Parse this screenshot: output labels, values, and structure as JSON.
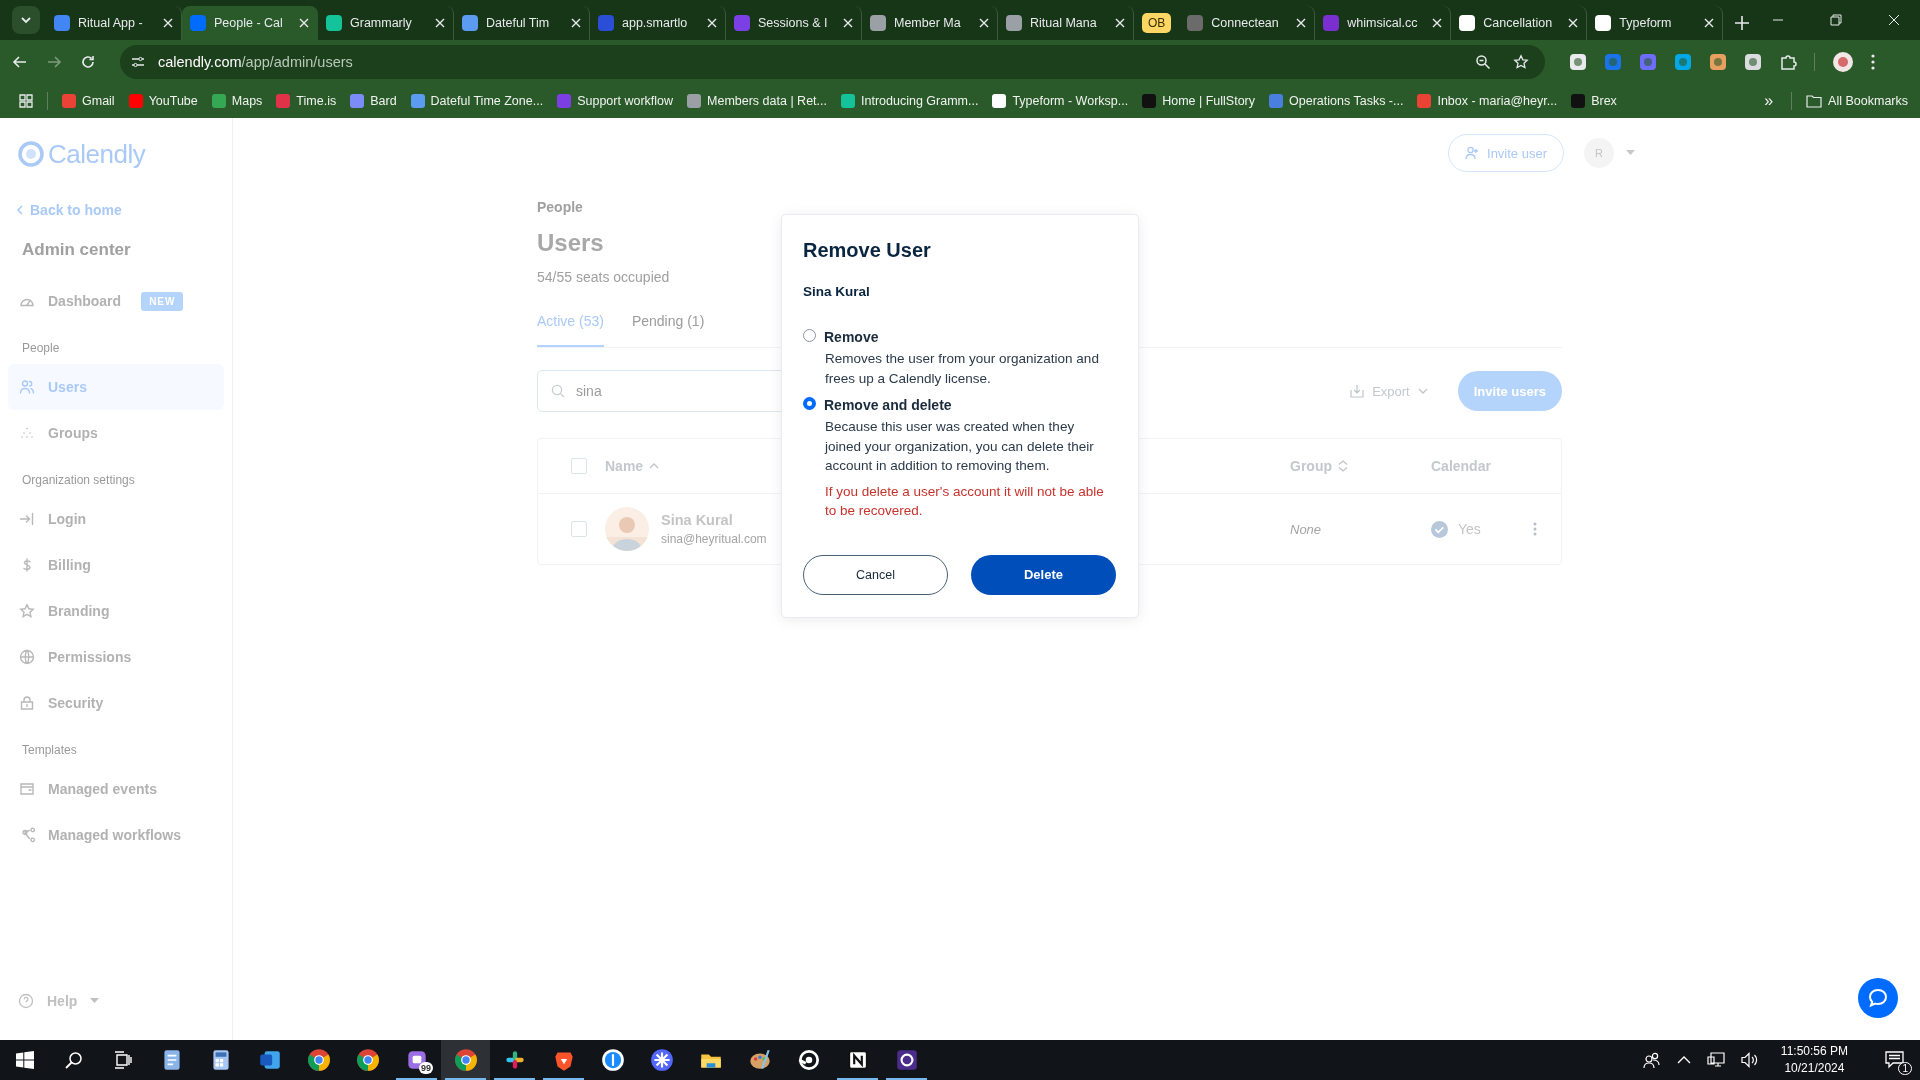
{
  "browser": {
    "tabs": [
      {
        "kind": "tab",
        "title": "Ritual App -",
        "selected": false
      },
      {
        "kind": "tab",
        "title": "People - Cal",
        "selected": true
      },
      {
        "kind": "tab",
        "title": "Grammarly",
        "selected": false
      },
      {
        "kind": "tab",
        "title": "Dateful Tim",
        "selected": false
      },
      {
        "kind": "tab",
        "title": "app.smartlo",
        "selected": false
      },
      {
        "kind": "tab",
        "title": "Sessions & I",
        "selected": false
      },
      {
        "kind": "tab",
        "title": "Member Ma",
        "selected": false
      },
      {
        "kind": "tab",
        "title": "Ritual Mana",
        "selected": false
      },
      {
        "kind": "group",
        "title": "OB"
      },
      {
        "kind": "tab",
        "title": "Connectean",
        "selected": false
      },
      {
        "kind": "tab",
        "title": "whimsical.cc",
        "selected": false
      },
      {
        "kind": "tab",
        "title": "Cancellation",
        "selected": false
      },
      {
        "kind": "tab",
        "title": "Typeform",
        "selected": false
      }
    ],
    "address": {
      "domain": "calendly.com",
      "path": "/app/admin/users"
    },
    "bookmarks": [
      {
        "label": "Gmail"
      },
      {
        "label": "YouTube"
      },
      {
        "label": "Maps"
      },
      {
        "label": "Time.is"
      },
      {
        "label": "Bard"
      },
      {
        "label": "Dateful Time Zone..."
      },
      {
        "label": "Support workflow"
      },
      {
        "label": "Members data | Ret..."
      },
      {
        "label": "Introducing Gramm..."
      },
      {
        "label": "Typeform - Worksp..."
      },
      {
        "label": "Home | FullStory"
      },
      {
        "label": "Operations Tasks -..."
      },
      {
        "label": "Inbox - maria@heyr..."
      },
      {
        "label": "Brex"
      }
    ],
    "bookmarks_more": "»",
    "all_bookmarks": "All Bookmarks"
  },
  "sidebar": {
    "logo": "Calendly",
    "back": "Back to home",
    "heading": "Admin center",
    "groups": [
      {
        "items": [
          {
            "label": "Dashboard",
            "badge": "NEW",
            "selected": false
          }
        ]
      },
      {
        "title": "People",
        "items": [
          {
            "label": "Users",
            "selected": true
          },
          {
            "label": "Groups",
            "selected": false
          }
        ]
      },
      {
        "title": "Organization settings",
        "items": [
          {
            "label": "Login",
            "selected": false
          },
          {
            "label": "Billing",
            "selected": false
          },
          {
            "label": "Branding",
            "selected": false
          },
          {
            "label": "Permissions",
            "selected": false
          },
          {
            "label": "Security",
            "selected": false
          }
        ]
      },
      {
        "title": "Templates",
        "items": [
          {
            "label": "Managed events",
            "selected": false
          },
          {
            "label": "Managed workflows",
            "selected": false
          }
        ]
      }
    ],
    "help": "Help"
  },
  "header": {
    "invite_user": "Invite user",
    "avatar": "R"
  },
  "page": {
    "breadcrumb": "People",
    "title": "Users",
    "seats": "54/55 seats occupied",
    "tabs": [
      {
        "label": "Active (53)",
        "selected": true
      },
      {
        "label": "Pending (1)",
        "selected": false
      }
    ],
    "search": {
      "value": "sina"
    },
    "export": "Export",
    "invite_users": "Invite users",
    "table": {
      "select_all_checked": false,
      "columns": [
        {
          "label": "Name",
          "sortable": true,
          "sorted": true
        },
        {
          "label": "Group",
          "sortable": true,
          "sorted": false
        },
        {
          "label": "Calendar"
        }
      ],
      "rows": [
        {
          "name": "Sina Kural",
          "email": "sina@heyritual.com",
          "group": "None",
          "calendar": "Yes",
          "checked": false
        }
      ]
    }
  },
  "dialog": {
    "title": "Remove User",
    "user": "Sina Kural",
    "options": [
      {
        "label": "Remove",
        "description": "Removes the user from your organization and frees up a Calendly license.",
        "selected": false
      },
      {
        "label": "Remove and delete",
        "description": "Because this user was created when they joined your organization, you can delete their account in addition to removing them.",
        "warning": "If you delete a user's account it will not be able to be recovered.",
        "selected": true
      }
    ],
    "cancel": "Cancel",
    "confirm": "Delete"
  },
  "taskbar": {
    "apps": [
      {
        "open": false,
        "selected": false
      },
      {
        "open": false,
        "selected": false
      },
      {
        "open": false,
        "selected": false
      },
      {
        "open": false,
        "selected": false
      },
      {
        "open": false,
        "selected": false
      },
      {
        "open": true,
        "selected": false,
        "badge": "99"
      },
      {
        "open": true,
        "selected": true
      },
      {
        "open": true,
        "selected": false
      },
      {
        "open": true,
        "selected": false
      },
      {
        "open": false,
        "selected": false
      },
      {
        "open": false,
        "selected": false
      },
      {
        "open": false,
        "selected": false
      },
      {
        "open": false,
        "selected": false
      },
      {
        "open": false,
        "selected": false
      },
      {
        "open": true,
        "selected": false
      },
      {
        "open": true,
        "selected": false
      }
    ],
    "time": "11:50:56 PM",
    "date": "10/21/2024",
    "notifications": "1"
  }
}
